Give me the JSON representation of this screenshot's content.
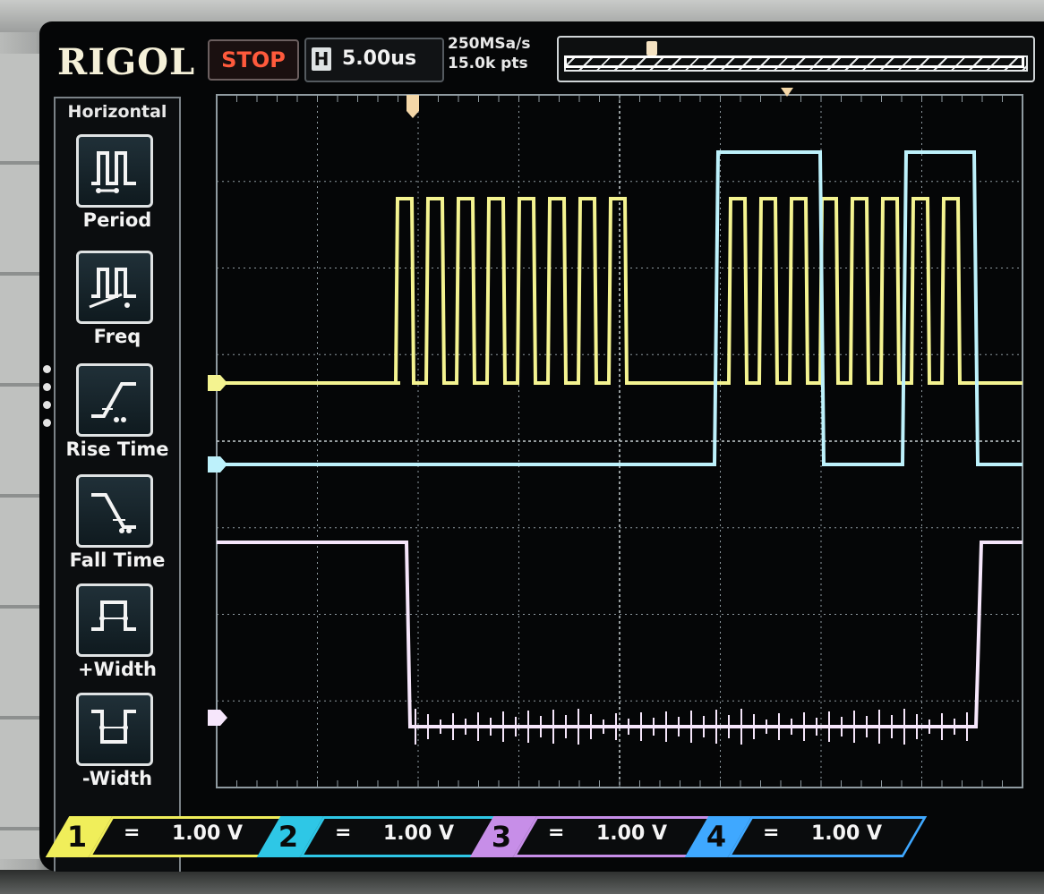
{
  "header": {
    "brand": "RIGOL",
    "run_status": "STOP",
    "timebase_badge": "H",
    "timebase": "5.00us",
    "sample_rate": "250MSa/s",
    "memory_depth": "15.0k pts",
    "trigger_position_fraction": 0.19
  },
  "menu": {
    "title": "Horizontal",
    "items": [
      {
        "label": "Period",
        "icon": "period-icon"
      },
      {
        "label": "Freq",
        "icon": "frequency-icon"
      },
      {
        "label": "Rise Time",
        "icon": "rise-time-icon"
      },
      {
        "label": "Fall Time",
        "icon": "fall-time-icon"
      },
      {
        "label": "+Width",
        "icon": "positive-width-icon"
      },
      {
        "label": "-Width",
        "icon": "negative-width-icon"
      }
    ]
  },
  "channels": [
    {
      "number": "1",
      "coupling": "=",
      "scale": "1.00 V",
      "color": "#f0ee5a"
    },
    {
      "number": "2",
      "coupling": "=",
      "scale": "1.00 V",
      "color": "#2ec7e6"
    },
    {
      "number": "3",
      "coupling": "=",
      "scale": "1.00 V",
      "color": "#c78ee8"
    },
    {
      "number": "4",
      "coupling": "=",
      "scale": "1.00 V",
      "color": "#3fa8ff"
    }
  ],
  "colors": {
    "ch1_trace": "#f4f390",
    "ch2_trace": "#bdf1fb",
    "ch3_trace": "#f6e6fb",
    "grid": "#8f9aa0",
    "background": "#050607"
  }
}
